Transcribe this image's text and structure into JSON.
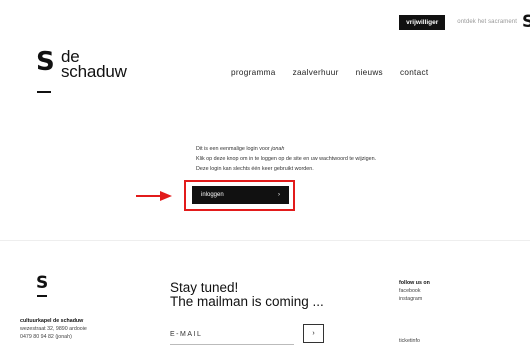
{
  "topbar": {
    "volunteer_label": "vrijwilliger",
    "discover_label": "ontdek het sacrament",
    "logo_letter": "S"
  },
  "logo": {
    "mark": "S",
    "line1": "de",
    "line2": "schaduw"
  },
  "nav": {
    "items": [
      {
        "label": "programma"
      },
      {
        "label": "zaalverhuur"
      },
      {
        "label": "nieuws"
      },
      {
        "label": "contact"
      }
    ]
  },
  "message": {
    "line1_prefix": "Dit is een eenmalige login voor ",
    "line1_user": "jonah",
    "line2": "Klik op deze knop om in te loggen op de site en uw wachtwoord te wijzigen.",
    "line3": "Deze login kan slechts één keer gebruikt worden."
  },
  "login": {
    "label": "inloggen",
    "arrow": "›"
  },
  "annotation": {
    "highlight_color": "#e21b1b"
  },
  "footer": {
    "logo_mark": "S",
    "org_name": "cultuurkapel de schaduw",
    "address": "wezestraat 32, 9890 ardooie",
    "phone": "0479 80 94 82 (jonah)",
    "newsletter_line1": "Stay tuned!",
    "newsletter_line2": "The mailman is coming ...",
    "email_placeholder": "E-MAIL",
    "submit_arrow": "›",
    "follow_heading": "follow us on",
    "social": [
      "facebook",
      "instagram"
    ],
    "ticket_label": "ticketinfo"
  }
}
